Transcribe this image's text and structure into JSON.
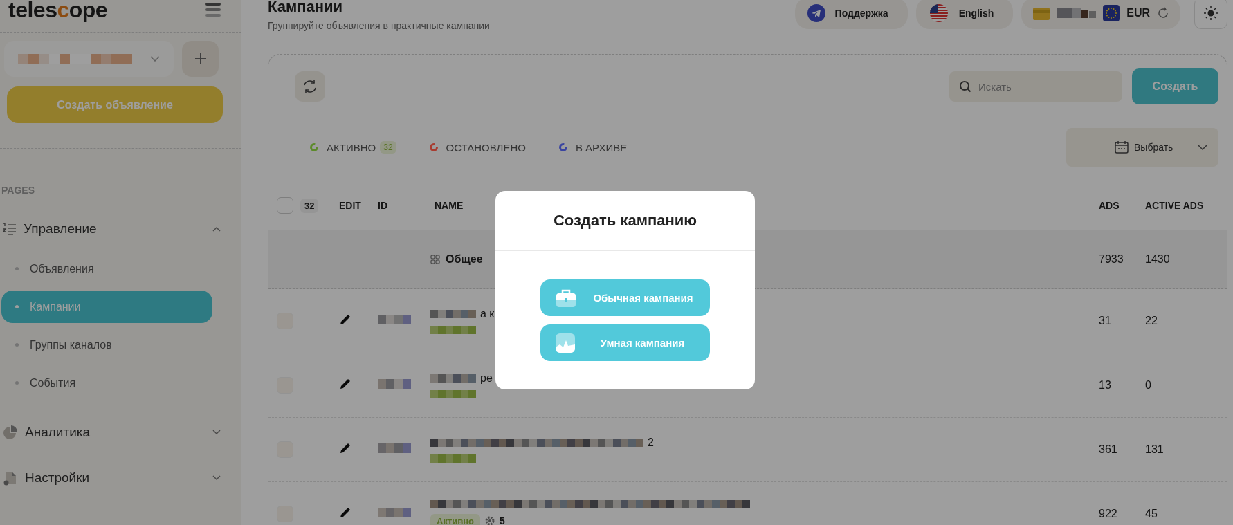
{
  "sidebar": {
    "logo_before": "teles",
    "logo_mark": "c",
    "logo_after": "ope",
    "create_ad_button": "Создать объявление",
    "section_label": "PAGES",
    "nav": [
      {
        "label": "Управление",
        "kind": "list",
        "expanded": true,
        "children": [
          {
            "label": "Объявления",
            "selected": false
          },
          {
            "label": "Кампании",
            "selected": true
          },
          {
            "label": "Группы каналов",
            "selected": false
          },
          {
            "label": "События",
            "selected": false
          }
        ]
      },
      {
        "label": "Аналитика",
        "kind": "pie",
        "expanded": false
      },
      {
        "label": "Настройки",
        "kind": "file",
        "expanded": false
      }
    ]
  },
  "header": {
    "title": "Кампании",
    "subtitle": "Группируйте объявления в практичные кампании",
    "support": "Поддержка",
    "language": "English",
    "currency": "EUR"
  },
  "toolbar": {
    "search": {
      "placeholder": "Искать"
    },
    "create_button": "Создать"
  },
  "status_tabs": [
    {
      "label": "АКТИВНО",
      "count": "32",
      "color": "#5c8a2a",
      "selected": false
    },
    {
      "label": "ОСТАНОВЛЕНО",
      "color": "#a83c30",
      "selected": false
    },
    {
      "label": "В АРХИВЕ",
      "color": "#3a44a0",
      "selected": false
    }
  ],
  "date_filter": {
    "label": "Выбрать"
  },
  "table": {
    "select_all": {
      "checked": false,
      "count": "32"
    },
    "columns": [
      "EDIT",
      "ID",
      "NAME",
      "ADS",
      "ACTIVE ADS"
    ],
    "summary": {
      "name": "Общее",
      "ads": "7933",
      "active_ads": "1430"
    },
    "rows": [
      {
        "checked": false,
        "name_fragment": "а к",
        "ads": "31",
        "active_ads": "22"
      },
      {
        "checked": false,
        "name_fragment": "ре",
        "ads": "13",
        "active_ads": "0"
      },
      {
        "checked": false,
        "name_fragment": "2",
        "ads": "361",
        "active_ads": "131"
      },
      {
        "checked": false,
        "status": "Активно",
        "rules": "5",
        "ads": "922",
        "active_ads": "45"
      }
    ]
  },
  "modal": {
    "title": "Создать кампанию",
    "options": [
      {
        "label": "Обычная кампания",
        "kind": "briefcase"
      },
      {
        "label": "Умная кампания",
        "kind": "chart"
      }
    ]
  }
}
